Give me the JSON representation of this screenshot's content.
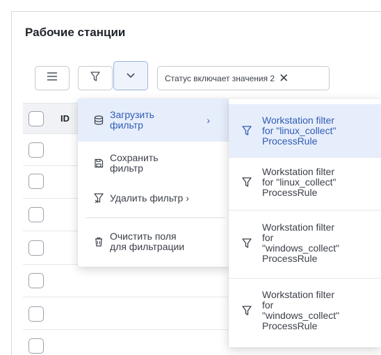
{
  "page": {
    "title": "Рабочие станции"
  },
  "toolbar": {
    "menu_icon": "hamburger-icon",
    "filter_icon": "filter-icon",
    "dropdown_icon": "chevron-down-icon",
    "chip_label": "Статус включает значения 2",
    "chip_close_icon": "close-icon"
  },
  "grid": {
    "id_header": "ID"
  },
  "filter_menu": {
    "items": [
      {
        "label": "Загрузить\nфильтр",
        "icon": "database-icon",
        "has_submenu": true
      },
      {
        "label": "Сохранить\nфильтр",
        "icon": "save-icon",
        "has_submenu": false
      },
      {
        "label": "Удалить фильтр",
        "icon": "filter-remove-icon",
        "has_submenu": true
      },
      {
        "label": "Очистить поля\nдля фильтрации",
        "icon": "trash-icon",
        "has_submenu": false
      }
    ],
    "chevron": "›"
  },
  "submenu": {
    "items": [
      {
        "label": "Workstation filter\nfor \"linux_collect\"\nProcessRule",
        "icon": "filter-icon",
        "highlighted": true
      },
      {
        "label": "Workstation filter\nfor \"linux_collect\"\nProcessRule",
        "icon": "filter-icon",
        "highlighted": false
      },
      {
        "label": "Workstation filter\nfor\n\"windows_collect\"\nProcessRule",
        "icon": "filter-icon",
        "highlighted": false
      },
      {
        "label": "Workstation filter\nfor\n\"windows_collect\"\nProcessRule",
        "icon": "filter-icon",
        "highlighted": false
      }
    ]
  },
  "colors": {
    "accent": "#2f5bb5",
    "highlight_bg": "#e7eefb"
  }
}
